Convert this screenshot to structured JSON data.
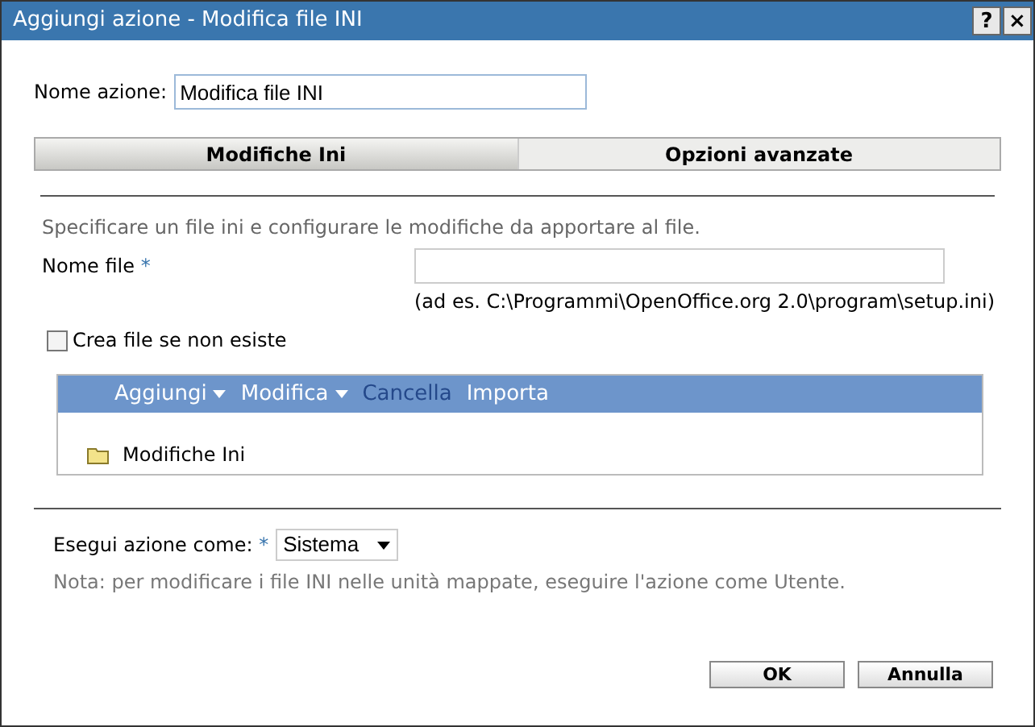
{
  "window": {
    "title": "Aggiungi azione - Modifica file INI",
    "controls": [
      "?",
      "×"
    ]
  },
  "action_name": {
    "label": "Nome azione:",
    "value": "Modifica file INI"
  },
  "tabs": [
    {
      "label": "Modifiche Ini",
      "selected": true
    },
    {
      "label": "Opzioni avanzate",
      "selected": false
    }
  ],
  "description": "Specificare un file ini e configurare le modifiche da apportare al file.",
  "file_name": {
    "label": "Nome file",
    "required": "*",
    "example": "(ad es. C:\\Programmi\\OpenOffice.org 2.0\\program\\setup.ini)"
  },
  "create_file": {
    "label": "Crea file se non esiste",
    "checked": false
  },
  "toolbar": [
    {
      "label": "Aggiungi",
      "kind": "menu",
      "disabled": false
    },
    {
      "label": "Modifica",
      "kind": "menu",
      "disabled": false
    },
    {
      "label": "Cancella",
      "kind": "action",
      "disabled": true
    },
    {
      "label": "Importa",
      "kind": "action",
      "disabled": false
    }
  ],
  "tree": [
    {
      "label": "Modifiche Ini"
    }
  ],
  "run_as": {
    "label": "Esegui azione come:",
    "required": "*",
    "value": "Sistema",
    "note": "Nota: per modificare i file INI nelle unità mappate, eseguire l'azione come Utente."
  },
  "buttons": [
    "OK",
    "Annulla"
  ]
}
